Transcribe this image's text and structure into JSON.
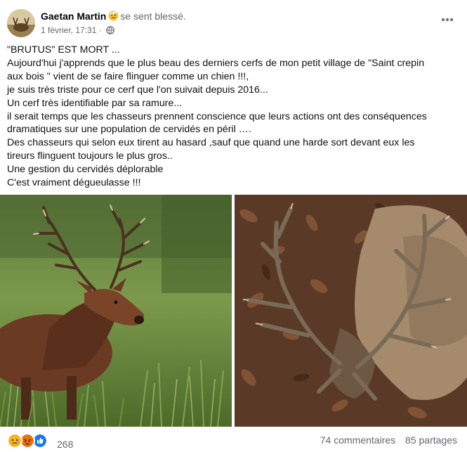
{
  "header": {
    "author": "Gaetan Martin",
    "feeling_text": "se sent blessé.",
    "feeling_icon": "hurt-face-emoji",
    "timestamp": "1 février, 17:31",
    "separator": "·",
    "privacy_icon": "globe-icon",
    "more_icon": "more-options-icon"
  },
  "post": {
    "lines": [
      "\"BRUTUS\" EST MORT ...",
      "Aujourd'hui j'apprends que le plus beau des derniers cerfs de mon petit village de \"Saint crepin",
      "aux bois \" vient de se faire flinguer comme un chien !!!,",
      "je suis très triste pour ce cerf que l'on suivait depuis 2016...",
      "Un cerf très identifiable par sa ramure...",
      " il serait temps que les chasseurs prennent conscience que leurs actions ont des conséquences",
      "dramatiques sur une population de cervidés en péril ….",
      "Des chasseurs qui selon eux tirent au hasard ,sauf que quand une harde sort devant eux les",
      "tireurs flinguent toujours le plus gros..",
      "Une gestion du cervidés déplorable",
      "C'est vraiment dégueulasse !!!"
    ]
  },
  "photos": {
    "left_icon": "living-stag-photo",
    "right_icon": "dead-stag-photo"
  },
  "footer": {
    "reaction_icons": [
      "sad-reaction-icon",
      "angry-reaction-icon",
      "like-reaction-icon"
    ],
    "reaction_count": "268",
    "comments": "74 commentaires",
    "shares": "85 partages"
  },
  "colors": {
    "secondary_text": "#65676b",
    "like_blue": "#1877f2",
    "angry_orange": "#e9710f",
    "sad_yellow": "#f7b125"
  }
}
